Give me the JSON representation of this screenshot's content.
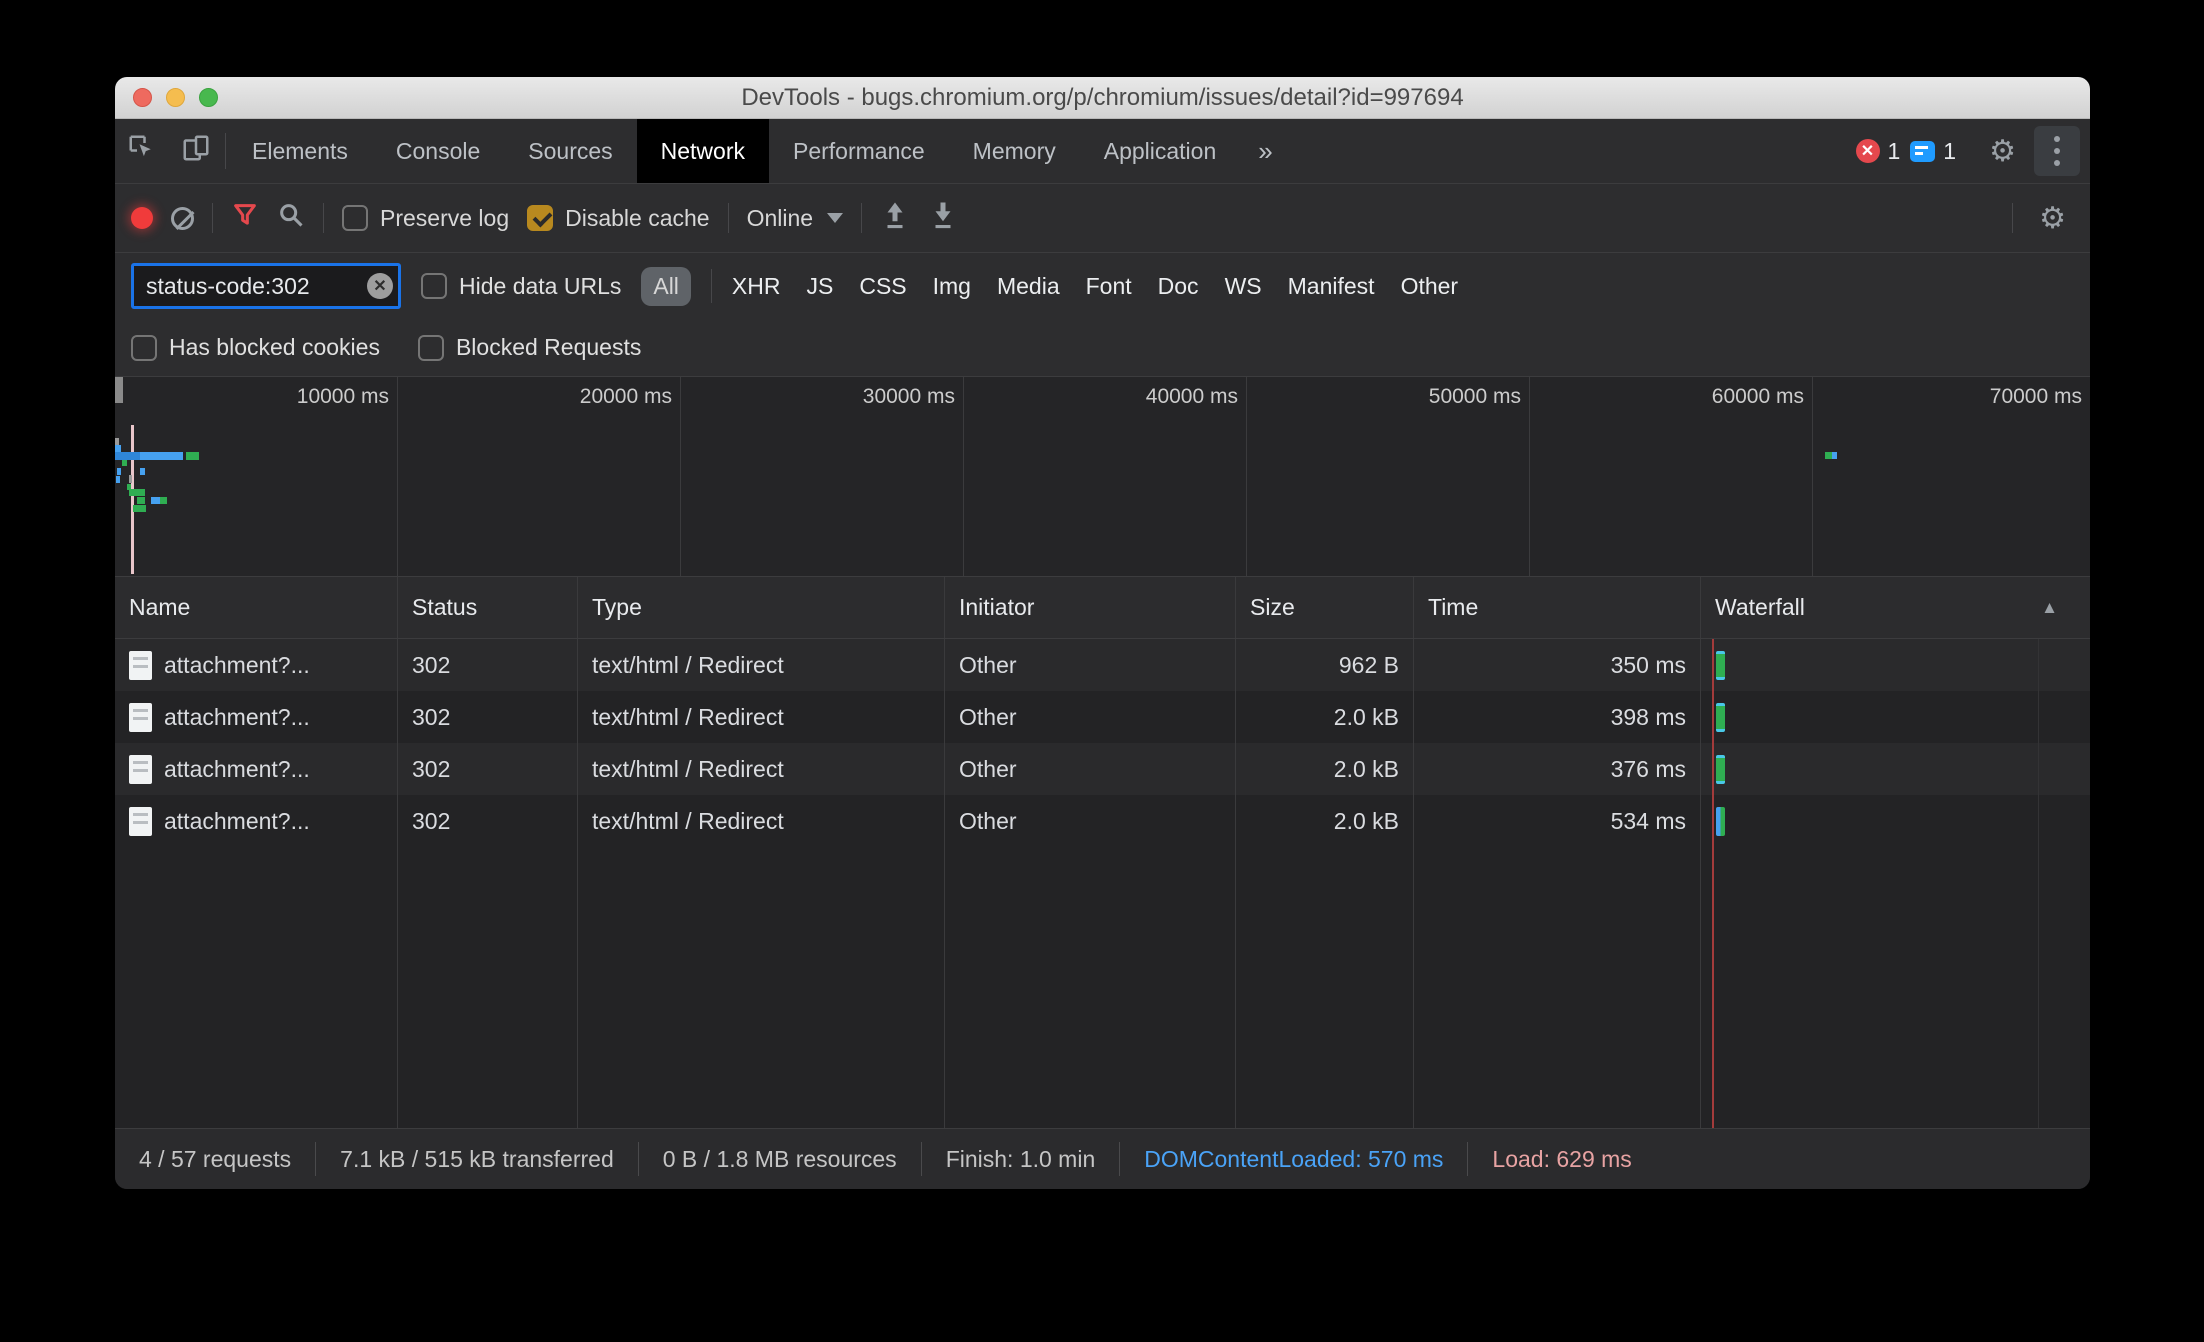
{
  "window": {
    "title": "DevTools - bugs.chromium.org/p/chromium/issues/detail?id=997694"
  },
  "tabs": {
    "items": [
      "Elements",
      "Console",
      "Sources",
      "Network",
      "Performance",
      "Memory",
      "Application"
    ],
    "selected": "Network",
    "overflow_label": "»",
    "error_count": "1",
    "issue_count": "1"
  },
  "toolbar": {
    "preserve_log_label": "Preserve log",
    "disable_cache_label": "Disable cache",
    "throttling_value": "Online"
  },
  "filter": {
    "value": "status-code:302",
    "hide_data_urls_label": "Hide data URLs",
    "types": [
      "All",
      "XHR",
      "JS",
      "CSS",
      "Img",
      "Media",
      "Font",
      "Doc",
      "WS",
      "Manifest",
      "Other"
    ],
    "selected_type": "All",
    "has_blocked_cookies_label": "Has blocked cookies",
    "blocked_requests_label": "Blocked Requests"
  },
  "timeline": {
    "labels": [
      "10000 ms",
      "20000 ms",
      "30000 ms",
      "40000 ms",
      "50000 ms",
      "60000 ms",
      "70000 ms"
    ]
  },
  "table": {
    "columns": [
      "Name",
      "Status",
      "Type",
      "Initiator",
      "Size",
      "Time",
      "Waterfall"
    ],
    "rows": [
      {
        "name": "attachment?...",
        "status": "302",
        "type": "text/html / Redirect",
        "initiator": "Other",
        "size": "962 B",
        "time": "350 ms"
      },
      {
        "name": "attachment?...",
        "status": "302",
        "type": "text/html / Redirect",
        "initiator": "Other",
        "size": "2.0 kB",
        "time": "398 ms"
      },
      {
        "name": "attachment?...",
        "status": "302",
        "type": "text/html / Redirect",
        "initiator": "Other",
        "size": "2.0 kB",
        "time": "376 ms"
      },
      {
        "name": "attachment?...",
        "status": "302",
        "type": "text/html / Redirect",
        "initiator": "Other",
        "size": "2.0 kB",
        "time": "534 ms"
      }
    ]
  },
  "footer": {
    "requests": "4 / 57 requests",
    "transferred": "7.1 kB / 515 kB transferred",
    "resources": "0 B / 1.8 MB resources",
    "finish": "Finish: 1.0 min",
    "dom_content_loaded": "DOMContentLoaded: 570 ms",
    "load": "Load: 629 ms"
  },
  "icons": {
    "inspect-icon": "cursor-in-box",
    "device-toolbar-icon": "phone-tablet",
    "gear-icon": "⚙",
    "more-menu-icon": "vertical-dots",
    "error-badge-icon": "red-circle-x",
    "issues-badge-icon": "blue-speech-bubble",
    "record-icon": "red-dot",
    "clear-icon": "slashed-circle",
    "filter-icon": "red-funnel",
    "search-icon": "magnifier",
    "export-har-icon": "up-arrow-underline",
    "import-har-icon": "down-arrow-underline",
    "close-icon": "✕",
    "dropdown-caret-icon": "▾",
    "sort-asc-icon": "▲",
    "document-icon": "page"
  },
  "colors": {
    "accent_blue": "#1a73e8",
    "checkbox_amber": "#b8891f",
    "record_red": "#f03b3b",
    "filter_red": "#e5484d",
    "waterfall_green": "#2fae52",
    "waterfall_blue": "#46a1f0",
    "load_line_red": "#a33b3b",
    "dcl_blue": "#4aa3f7",
    "load_pink": "#e8a3a3"
  }
}
